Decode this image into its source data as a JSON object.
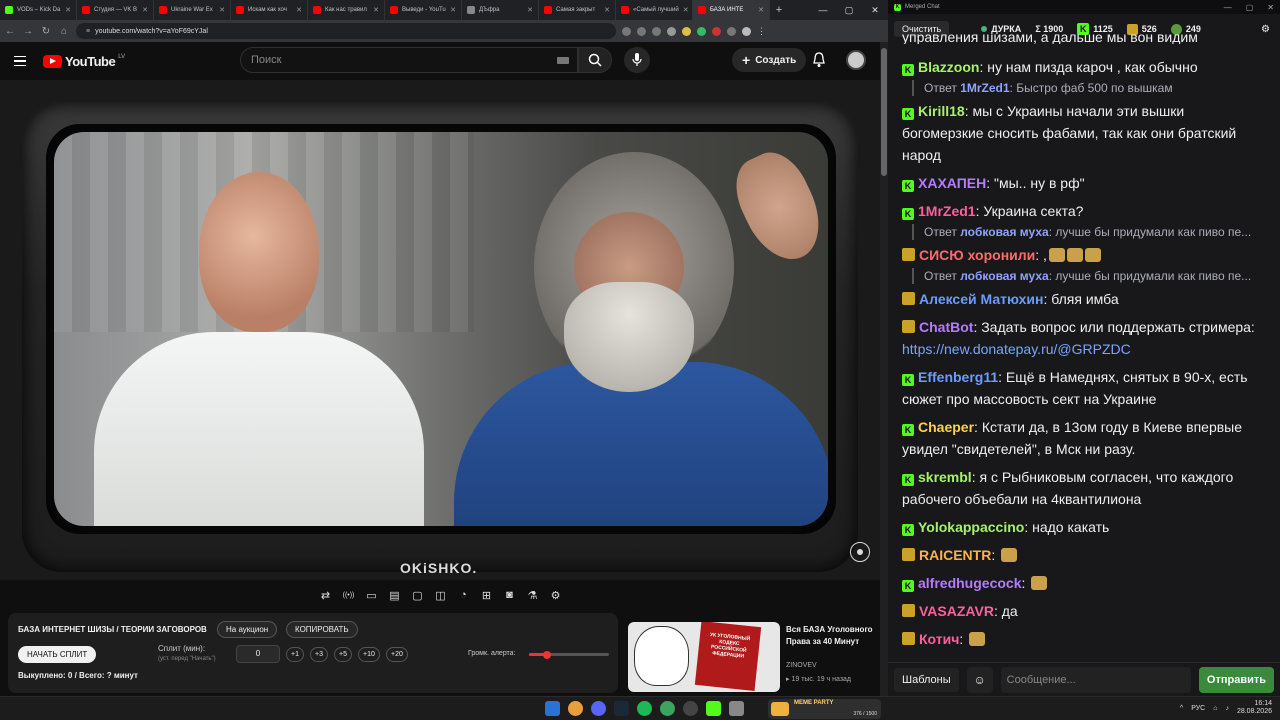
{
  "browser": {
    "tabs": [
      {
        "label": "VODs – Kick Da",
        "color": "#53fc18"
      },
      {
        "label": "Студия — VK В",
        "color": "#ff0000"
      },
      {
        "label": "Ukraine War Ex",
        "color": "#ff0000"
      },
      {
        "label": "Искам как хоч",
        "color": "#ff0000"
      },
      {
        "label": "Как нас травил",
        "color": "#ff0000"
      },
      {
        "label": "Выведи - YouTu",
        "color": "#ff0000"
      },
      {
        "label": "ДЪфра",
        "color": "#888888"
      },
      {
        "label": "Самая закрыт",
        "color": "#ff0000"
      },
      {
        "label": "«Самый лучший",
        "color": "#ff0000"
      },
      {
        "label": "БАЗА ИНТЕ",
        "color": "#ff0000"
      }
    ],
    "url": "youtube.com/watch?v=aYoF69cYJal"
  },
  "youtube": {
    "logo": "YouTube",
    "country": "LV",
    "search_placeholder": "Поиск",
    "create_label": "Создать",
    "watermark": "OKiSHKO."
  },
  "toolbar_icons": [
    "loop-icon",
    "broadcast-icon",
    "screen-icon",
    "film-icon",
    "frame-icon",
    "pip-icon",
    "speed-icon",
    "add-icon",
    "camera-icon",
    "flask-icon",
    "gear-icon"
  ],
  "panel": {
    "title": "БАЗА ИНТЕРНЕТ ШИЗЫ / ТЕОРИИ ЗАГОВОРОВ",
    "auction_label": "На аукцион",
    "copy_label": "КОПИРОВАТЬ",
    "start_split_label": "НАЧАТЬ СПЛИТ",
    "split_label": "Сплит (мин):",
    "split_hint": "(уст. перед \"Начать\")",
    "split_value": "0",
    "increments": [
      "+1",
      "+3",
      "+5",
      "+10",
      "+20"
    ],
    "volume_label": "Громк. алерта:",
    "volume_level": 0.22,
    "bought_text": "Выкуплено: 0 / Всего: ? минут"
  },
  "recommended": {
    "title": "Вся БАЗА Уголовного Права за 40 Минут",
    "channel": "ZINOVEV",
    "meta": "▸ 19 тыс.   19 ч назад",
    "book_text": "УК УГОЛОВНЫЙ КОДЕКС РОССИЙСКОЙ ФЕДЕРАЦИИ"
  },
  "chat": {
    "window_title": "Merged Chat",
    "clear_label": "Очистить",
    "channel": "ДУРКА",
    "sum": "Σ 1900",
    "kick_count": "1125",
    "stat2": "526",
    "stat3": "249",
    "top_text": "управления шизами, а дальше мы вон видим",
    "messages": [
      {
        "platform": "kick",
        "user": "Blazzoon",
        "color": "#a8f06a",
        "text": "ну нам пизда кароч , как обычно"
      },
      {
        "reply": true,
        "reply_user": "1MrZed1",
        "reply_color": "#8fa3ff",
        "text": "Быстро фаб 500 по вышкам"
      },
      {
        "platform": "kick",
        "user": "Kirill18",
        "color": "#a8f06a",
        "text": "мы с Украины начали эти вышки богомерзкие сносить фабами, так как они братский народ"
      },
      {
        "platform": "kick",
        "user": "ХАХАПЕН",
        "color": "#b67bff",
        "text": "\"мы.. ну в рф\""
      },
      {
        "platform": "kick",
        "user": "1MrZed1",
        "color": "#ff5f9e",
        "text": "Украина секта?"
      },
      {
        "reply": true,
        "reply_user": "лобковая муха",
        "reply_color": "#8fa3ff",
        "text": "лучше бы придумали как пиво пе..."
      },
      {
        "platform": "tw",
        "user": "СИСЮ хоронили",
        "color": "#ff6b6b",
        "text": ",",
        "emotes": 3
      },
      {
        "reply": true,
        "reply_user": "лобковая муха",
        "reply_color": "#8fa3ff",
        "text": "лучше бы придумали как пиво пе..."
      },
      {
        "platform": "tw",
        "user": "Алексей Матюхин",
        "color": "#6b9cff",
        "text": "бляя имба"
      },
      {
        "platform": "tw",
        "user": "ChatBot",
        "color": "#b67bff",
        "text": "Задать вопрос или поддержать стримера: ",
        "link": "https://new.donatepay.ru/@GRPZDC"
      },
      {
        "platform": "kick",
        "user": "Effenberg11",
        "color": "#6b9cff",
        "text": "Ещё в Намеднях, снятых в 90-х, есть сюжет про массовость сект на Украине"
      },
      {
        "platform": "kick",
        "user": "Chaeper",
        "color": "#ffd24d",
        "text": "Кстати да, в 13ом году в Киеве впервые увидел \"свидетелей\", в Мск ни разу."
      },
      {
        "platform": "kick",
        "user": "skrembl",
        "color": "#a8f06a",
        "text": "я с Рыбниковым согласен, что каждого рабочего объебали на 4квантилиона"
      },
      {
        "platform": "kick",
        "user": "Yolokappaccino",
        "color": "#a8f06a",
        "text": "надо какать"
      },
      {
        "platform": "tw",
        "user": "RAICENTR",
        "color": "#ffb347",
        "text": "",
        "emotes": 1
      },
      {
        "platform": "kick",
        "user": "alfredhugecock",
        "color": "#b67bff",
        "text": "",
        "emotes": 1
      },
      {
        "platform": "tw",
        "user": "VASAZAVR",
        "color": "#ff5f9e",
        "text": "да"
      },
      {
        "platform": "tw",
        "user": "Котич",
        "color": "#ff5f9e",
        "text": "",
        "emotes": 1
      }
    ],
    "template_label": "Шаблоны",
    "input_placeholder": "Сообщение...",
    "send_label": "Отправить"
  },
  "taskbar": {
    "widget_title": "MEME PARTY",
    "widget_count": "376 / 1500",
    "lang": "РУС",
    "time": "16:14",
    "date": "28.08.2026"
  }
}
